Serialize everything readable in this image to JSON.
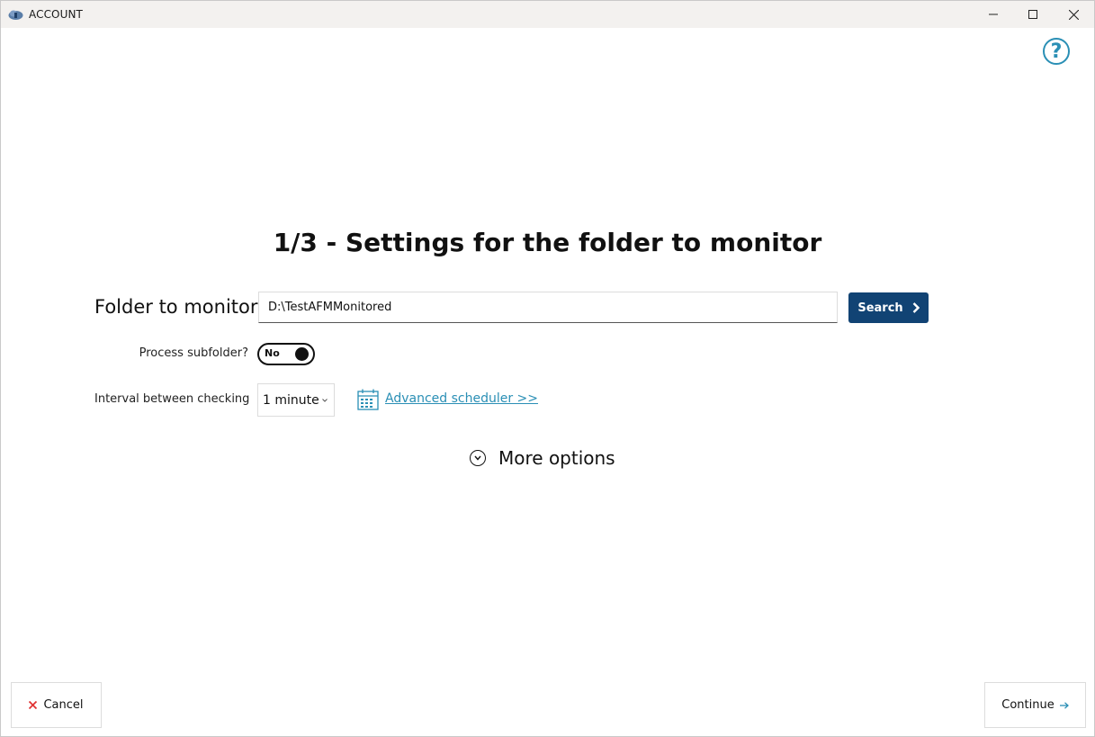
{
  "window": {
    "title": "ACCOUNT",
    "minimize_icon": "minimize-icon",
    "maximize_icon": "maximize-icon",
    "close_icon": "close-icon"
  },
  "help": {
    "glyph": "?",
    "icon": "help-icon"
  },
  "heading": "1/3 - Settings for the folder to monitor",
  "folder": {
    "label": "Folder to monitor",
    "value": "D:\\TestAFMMonitored",
    "search_label": "Search"
  },
  "subfolder": {
    "label": "Process subfolder?",
    "toggle_text": "No",
    "enabled": false
  },
  "interval": {
    "label": "Interval between checking",
    "selected": "1 minute",
    "advanced_link": "Advanced scheduler >>"
  },
  "more_options": {
    "label": "More options"
  },
  "footer": {
    "cancel_label": "Cancel",
    "continue_label": "Continue"
  },
  "colors": {
    "accent": "#2a8fb5",
    "primary_button": "#114374",
    "cancel_icon": "#e03535",
    "titlebar": "#f3f1ef"
  }
}
